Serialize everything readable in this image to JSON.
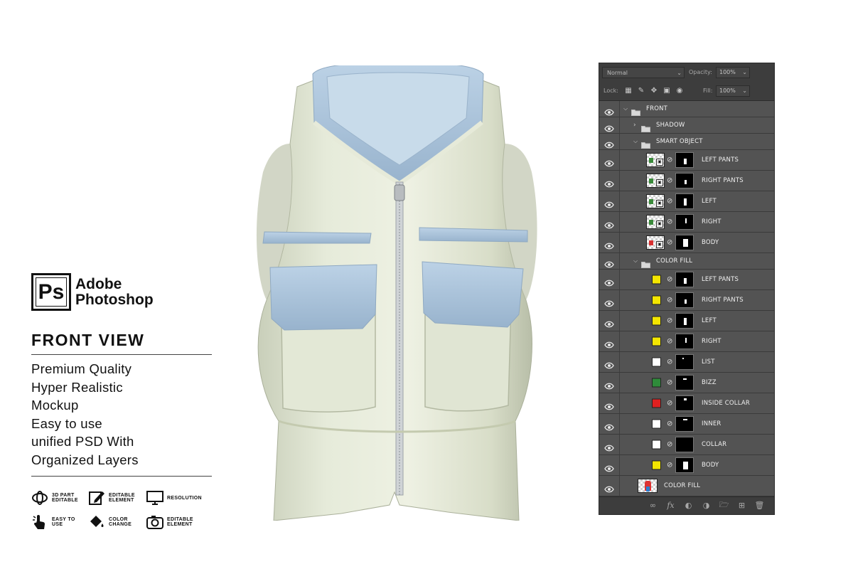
{
  "brand": {
    "logo_letters": "Ps",
    "line1": "Adobe",
    "line2": "Photoshop"
  },
  "heading": "FRONT VIEW",
  "features": [
    "Premium Quality",
    "Hyper Realistic",
    "Mockup",
    "Easy to use",
    "unified PSD With",
    "Organized Layers"
  ],
  "badges": [
    {
      "icon": "3d-part-icon",
      "text": "3D PART EDITABLE"
    },
    {
      "icon": "edit-element-icon",
      "text": "EDITABLE ELEMENT"
    },
    {
      "icon": "monitor-icon",
      "text": "RESOLUTION"
    },
    {
      "icon": "hand-click-icon",
      "text": "EASY TO USE"
    },
    {
      "icon": "paint-bucket-icon",
      "text": "COLOR CHANGE"
    },
    {
      "icon": "camera-icon",
      "text": "EDITABLE ELEMENT"
    }
  ],
  "product": {
    "colors": {
      "body": "#e2e8d6",
      "trim": "#a9c3dc"
    }
  },
  "panel": {
    "blend_mode": "Normal",
    "opacity_label": "Opacity:",
    "opacity_value": "100%",
    "lock_label": "Lock:",
    "fill_label": "Fill:",
    "fill_value": "100%",
    "layers": [
      {
        "name": "FRONT",
        "kind": "group",
        "expanded": true,
        "depth": 0
      },
      {
        "name": "SHADOW",
        "kind": "group",
        "expanded": false,
        "depth": 1
      },
      {
        "name": "SMART OBJECT",
        "kind": "group",
        "expanded": true,
        "depth": 1
      },
      {
        "name": "LEFT PANTS",
        "kind": "smart",
        "depth": 2,
        "accent": "#3a8a3a"
      },
      {
        "name": "RIGHT PANTS",
        "kind": "smart",
        "depth": 2,
        "accent": "#3a8a3a"
      },
      {
        "name": "LEFT",
        "kind": "smart",
        "depth": 2,
        "accent": "#3a8a3a"
      },
      {
        "name": "RIGHT",
        "kind": "smart",
        "depth": 2,
        "accent": "#3a8a3a"
      },
      {
        "name": "BODY",
        "kind": "smart",
        "depth": 2,
        "accent": "#d83030"
      },
      {
        "name": "COLOR FILL",
        "kind": "group",
        "expanded": true,
        "depth": 1
      },
      {
        "name": "LEFT PANTS",
        "kind": "fill",
        "depth": 2,
        "color": "#f4e600"
      },
      {
        "name": "RIGHT PANTS",
        "kind": "fill",
        "depth": 2,
        "color": "#f4e600"
      },
      {
        "name": "LEFT",
        "kind": "fill",
        "depth": 2,
        "color": "#f4e600"
      },
      {
        "name": "RIGHT",
        "kind": "fill",
        "depth": 2,
        "color": "#f4e600"
      },
      {
        "name": "LIST",
        "kind": "fill",
        "depth": 2,
        "color": "#ffffff"
      },
      {
        "name": "BIZZ",
        "kind": "fill",
        "depth": 2,
        "color": "#2e8b3a"
      },
      {
        "name": "INSIDE COLLAR",
        "kind": "fill",
        "depth": 2,
        "color": "#e02020"
      },
      {
        "name": "INNER",
        "kind": "fill",
        "depth": 2,
        "color": "#ffffff"
      },
      {
        "name": "COLLAR",
        "kind": "fill",
        "depth": 2,
        "color": "#ffffff"
      },
      {
        "name": "BODY",
        "kind": "fill",
        "depth": 2,
        "color": "#f4e600"
      },
      {
        "name": "COLOR FILL",
        "kind": "image",
        "depth": 1
      }
    ],
    "bottom_icons": [
      "link-icon",
      "fx-icon",
      "add-mask-icon",
      "adjustment-icon",
      "new-group-icon",
      "new-layer-icon",
      "trash-icon"
    ]
  }
}
